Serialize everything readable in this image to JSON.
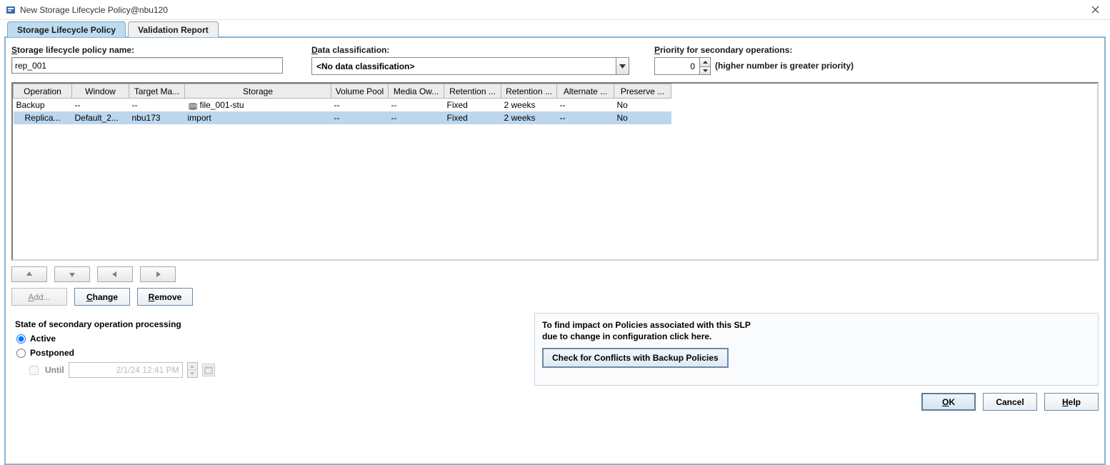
{
  "window": {
    "title": "New Storage Lifecycle Policy@nbu120"
  },
  "tabs": {
    "policy": "Storage Lifecycle Policy",
    "validation": "Validation Report"
  },
  "labels": {
    "name": "Storage lifecycle policy name:",
    "data_class": "Data classification:",
    "priority": "Priority for secondary operations:",
    "priority_hint": "(higher number is greater priority)"
  },
  "fields": {
    "name_value": "rep_001",
    "data_class_value": "<No data classification>",
    "priority_value": "0"
  },
  "table": {
    "headers": [
      "Operation",
      "Window",
      "Target Ma...",
      "Storage",
      "Volume Pool",
      "Media Ow...",
      "Retention ...",
      "Retention ...",
      "Alternate ...",
      "Preserve ..."
    ],
    "rows": [
      {
        "operation": "Backup",
        "window": "--",
        "target": "--",
        "storage_icon": true,
        "storage": "file_001-stu",
        "volume": "--",
        "media": "--",
        "ret1": "Fixed",
        "ret2": "2 weeks",
        "alt": "--",
        "preserve": "No",
        "selected": false,
        "indent": false
      },
      {
        "operation": "Replica...",
        "window": "Default_2...",
        "target": "nbu173",
        "storage_icon": false,
        "storage": "import",
        "volume": "--",
        "media": "--",
        "ret1": "Fixed",
        "ret2": "2 weeks",
        "alt": "--",
        "preserve": "No",
        "selected": true,
        "indent": true
      }
    ]
  },
  "actions": {
    "add": "Add...",
    "change": "Change",
    "remove": "Remove"
  },
  "secondary": {
    "header": "State of secondary operation processing",
    "active": "Active",
    "postponed": "Postponed",
    "until": "Until",
    "until_value": "2/1/24 12:41 PM"
  },
  "impact": {
    "line1": "To find impact on Policies associated with this SLP",
    "line2": "due to change in configuration click here.",
    "button": "Check for Conflicts with Backup Policies"
  },
  "footer": {
    "ok": "OK",
    "cancel": "Cancel",
    "help": "Help"
  }
}
